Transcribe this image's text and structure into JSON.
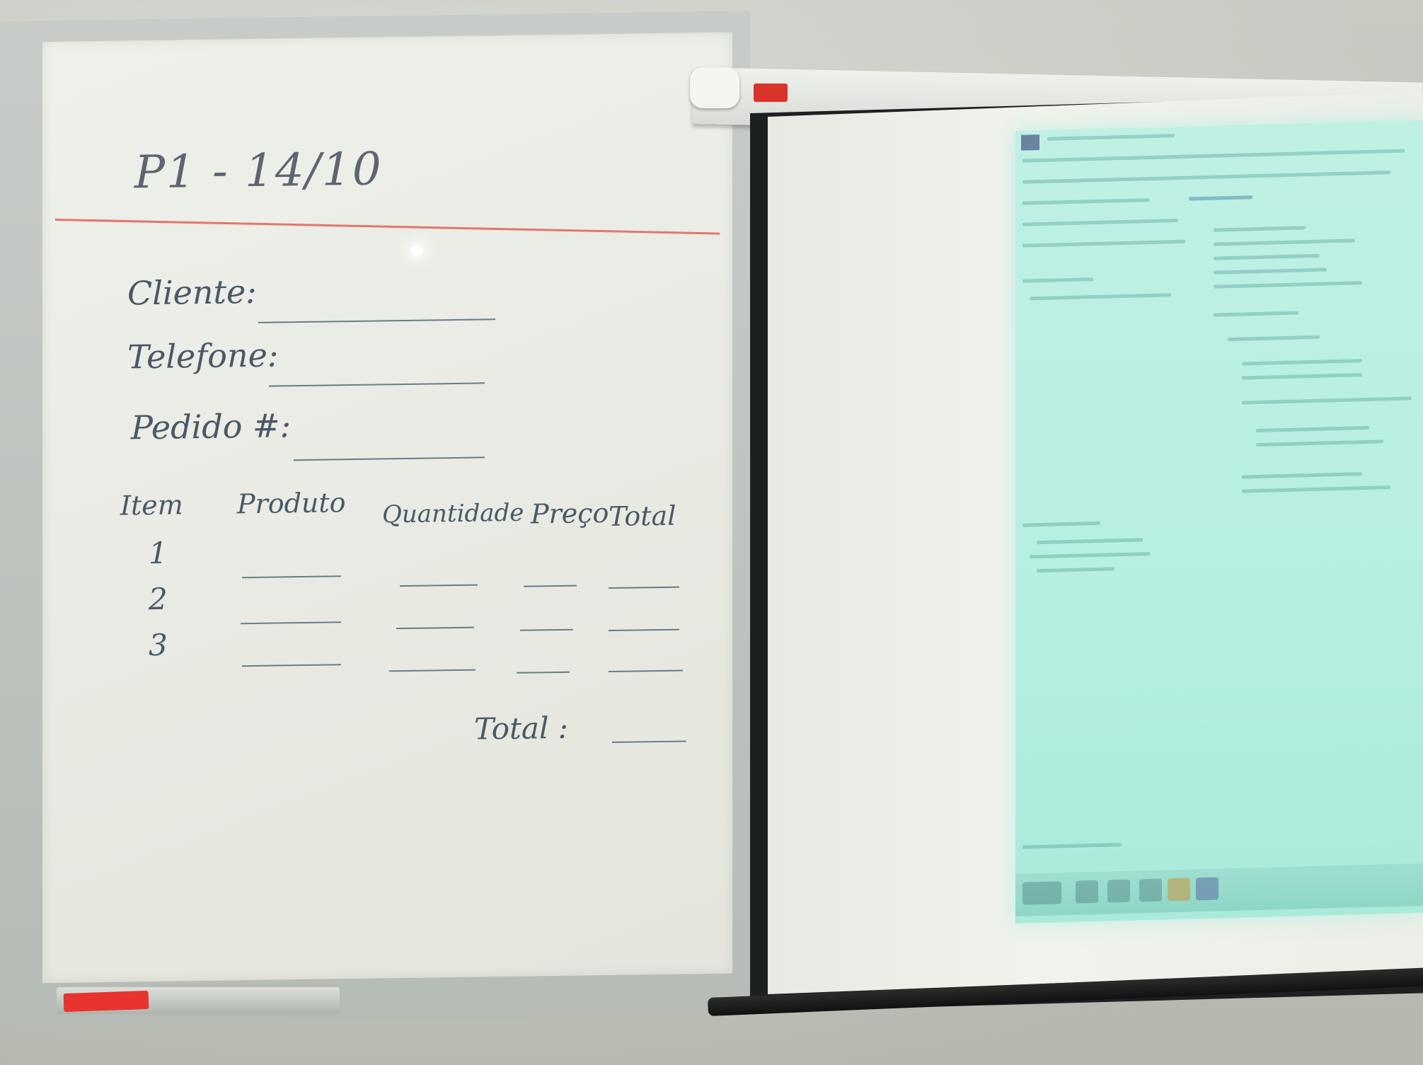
{
  "whiteboard": {
    "title": "P1 - 14/10",
    "fields": {
      "cliente": "Cliente:",
      "telefone": "Telefone:",
      "pedido": "Pedido #:"
    },
    "columns": [
      "Item",
      "Produto",
      "Quantidade",
      "Preço",
      "Total"
    ],
    "rows": [
      "1",
      "2",
      "3"
    ],
    "total_label": "Total :"
  },
  "colors": {
    "marker_blue": "#4a5966",
    "rule_red": "#e2776d",
    "projection_cyan": "#bff0e4",
    "eraser_red": "#e8332f"
  },
  "icons": {
    "projector_logo": "brand-logo-icon",
    "ide_logo": "visual-studio-icon"
  }
}
